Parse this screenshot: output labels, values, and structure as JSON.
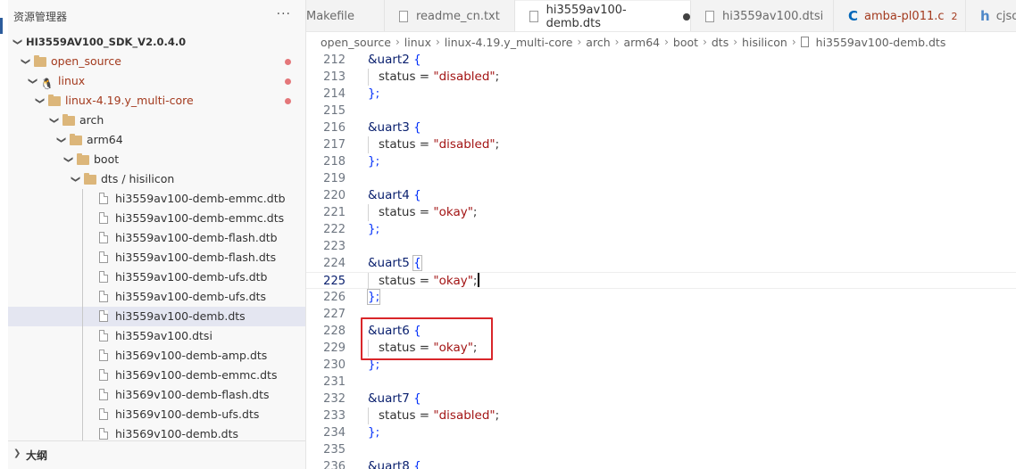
{
  "sidebar": {
    "title": "资源管理器",
    "more": "···",
    "root": "HI3559AV100_SDK_V2.0.4.0",
    "folders": [
      {
        "label": "open_source",
        "modified": true,
        "dot": true
      },
      {
        "label": "linux",
        "modified": true,
        "dot": true
      },
      {
        "label": "linux-4.19.y_multi-core",
        "modified": true,
        "dot": true
      },
      {
        "label": "arch",
        "modified": false
      },
      {
        "label": "arm64",
        "modified": false
      },
      {
        "label": "boot",
        "modified": false
      },
      {
        "label": "dts / hisilicon",
        "modified": false
      }
    ],
    "files": [
      "hi3559av100-demb-emmc.dtb",
      "hi3559av100-demb-emmc.dts",
      "hi3559av100-demb-flash.dtb",
      "hi3559av100-demb-flash.dts",
      "hi3559av100-demb-ufs.dtb",
      "hi3559av100-demb-ufs.dts",
      "hi3559av100-demb.dts",
      "hi3559av100.dtsi",
      "hi3569v100-demb-amp.dts",
      "hi3569v100-demb-emmc.dts",
      "hi3569v100-demb-flash.dts",
      "hi3569v100-demb-ufs.dts",
      "hi3569v100-demb.dts"
    ],
    "selected_file": "hi3559av100-demb.dts",
    "outline": "大纲"
  },
  "tabs": [
    {
      "label": "Makefile",
      "icon": "none"
    },
    {
      "label": "readme_cn.txt",
      "icon": "file-icon"
    },
    {
      "label": "hi3559av100-demb.dts",
      "icon": "file-icon",
      "active": true,
      "dirty": true
    },
    {
      "label": "hi3559av100.dtsi",
      "icon": "file-icon"
    },
    {
      "label": "amba-pl011.c",
      "icon": "c-icon",
      "modified": true,
      "count": "2"
    },
    {
      "label": "cjso",
      "icon": "h-icon"
    }
  ],
  "breadcrumb": [
    "open_source",
    "linux",
    "linux-4.19.y_multi-core",
    "arch",
    "arm64",
    "boot",
    "dts",
    "hisilicon",
    "hi3559av100-demb.dts"
  ],
  "editor": {
    "current_line": 225,
    "lines": [
      {
        "n": "212",
        "kind": "open",
        "node": "&uart2",
        "brace": "{"
      },
      {
        "n": "213",
        "kind": "prop",
        "prop": "status",
        "eq": " = ",
        "value": "\"disabled\"",
        "end": ";"
      },
      {
        "n": "214",
        "kind": "close",
        "text": "};"
      },
      {
        "n": "215",
        "kind": "blank"
      },
      {
        "n": "216",
        "kind": "open",
        "node": "&uart3",
        "brace": "{"
      },
      {
        "n": "217",
        "kind": "prop",
        "prop": "status",
        "eq": " = ",
        "value": "\"disabled\"",
        "end": ";"
      },
      {
        "n": "218",
        "kind": "close",
        "text": "};"
      },
      {
        "n": "219",
        "kind": "blank"
      },
      {
        "n": "220",
        "kind": "open",
        "node": "&uart4",
        "brace": "{"
      },
      {
        "n": "221",
        "kind": "prop",
        "prop": "status",
        "eq": " = ",
        "value": "\"okay\"",
        "end": ";"
      },
      {
        "n": "222",
        "kind": "close",
        "text": "};"
      },
      {
        "n": "223",
        "kind": "blank"
      },
      {
        "n": "224",
        "kind": "open",
        "node": "&uart5",
        "brace": "{"
      },
      {
        "n": "225",
        "kind": "prop",
        "prop": "status",
        "eq": " = ",
        "value": "\"okay\"",
        "end": ";"
      },
      {
        "n": "226",
        "kind": "close",
        "text": "};"
      },
      {
        "n": "227",
        "kind": "blank"
      },
      {
        "n": "228",
        "kind": "open",
        "node": "&uart6",
        "brace": "{"
      },
      {
        "n": "229",
        "kind": "prop",
        "prop": "status",
        "eq": " = ",
        "value": "\"okay\"",
        "end": ";"
      },
      {
        "n": "230",
        "kind": "close",
        "text": "};"
      },
      {
        "n": "231",
        "kind": "blank"
      },
      {
        "n": "232",
        "kind": "open",
        "node": "&uart7",
        "brace": "{"
      },
      {
        "n": "233",
        "kind": "prop",
        "prop": "status",
        "eq": " = ",
        "value": "\"disabled\"",
        "end": ";"
      },
      {
        "n": "234",
        "kind": "close",
        "text": "};"
      },
      {
        "n": "235",
        "kind": "blank"
      },
      {
        "n": "236",
        "kind": "open",
        "node": "&uart8",
        "brace": "{"
      }
    ]
  },
  "colors": {
    "highlight_box": "#d9262a",
    "modified_text": "#a33a1e",
    "string": "#a31515",
    "node": "#0b216f",
    "brace": "#0431fa"
  }
}
